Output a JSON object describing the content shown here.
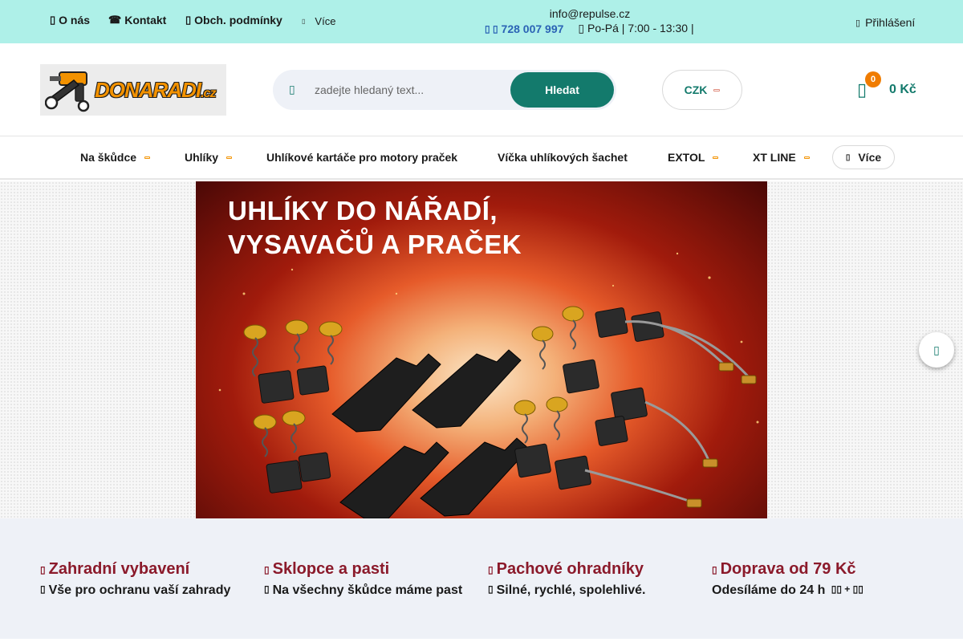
{
  "topbar": {
    "links": [
      {
        "icon": "info-icon",
        "glyph": "▯",
        "label": "O nás"
      },
      {
        "icon": "phone-icon",
        "glyph": "☎",
        "label": "Kontakt"
      },
      {
        "icon": "document-icon",
        "glyph": "▯",
        "label": "Obch. podmínky"
      }
    ],
    "more_label": "Více",
    "email": "info@repulse.cz",
    "phone": "728 007 997",
    "hours": "Po-Pá | 7:00 - 13:30 |",
    "login_label": "Přihlášení"
  },
  "header": {
    "logo_text": "DONARADI",
    "logo_suffix": ".cz",
    "search_placeholder": "zadejte hledaný text...",
    "search_button": "Hledat",
    "currency": "CZK",
    "cart_count": "0",
    "cart_total": "0 Kč"
  },
  "nav": {
    "items": [
      {
        "label": "Na škůdce",
        "has_dropdown": true
      },
      {
        "label": "Uhlíky",
        "has_dropdown": true
      },
      {
        "label": "Uhlíkové kartáče pro motory praček",
        "has_dropdown": false
      },
      {
        "label": "Víčka uhlíkových šachet",
        "has_dropdown": false
      },
      {
        "label": "EXTOL",
        "has_dropdown": true
      },
      {
        "label": "XT LINE",
        "has_dropdown": true
      }
    ],
    "more_label": "Více"
  },
  "banner": {
    "line1": "UHLÍKY DO NÁŘADÍ,",
    "line2": "VYSAVAČŮ A PRAČEK"
  },
  "benefits": [
    {
      "title": "Zahradní vybavení",
      "text": "Vše pro ochranu vaší zahrady",
      "icon": "garden-icon"
    },
    {
      "title": "Sklopce a pasti",
      "text": "Na všechny škůdce máme past",
      "icon": "trap-icon"
    },
    {
      "title": "Pachové ohradníky",
      "text": "Silné, rychlé, spolehlivé.",
      "icon": "scent-icon"
    },
    {
      "title": "Doprava od 79 Kč",
      "text": "Odesíláme do 24 h",
      "icon": "truck-icon"
    }
  ],
  "colors": {
    "topbar": "#aef0e8",
    "accent": "#137a6c",
    "benefit_title": "#8b1a2b",
    "badge": "#f07c00"
  }
}
